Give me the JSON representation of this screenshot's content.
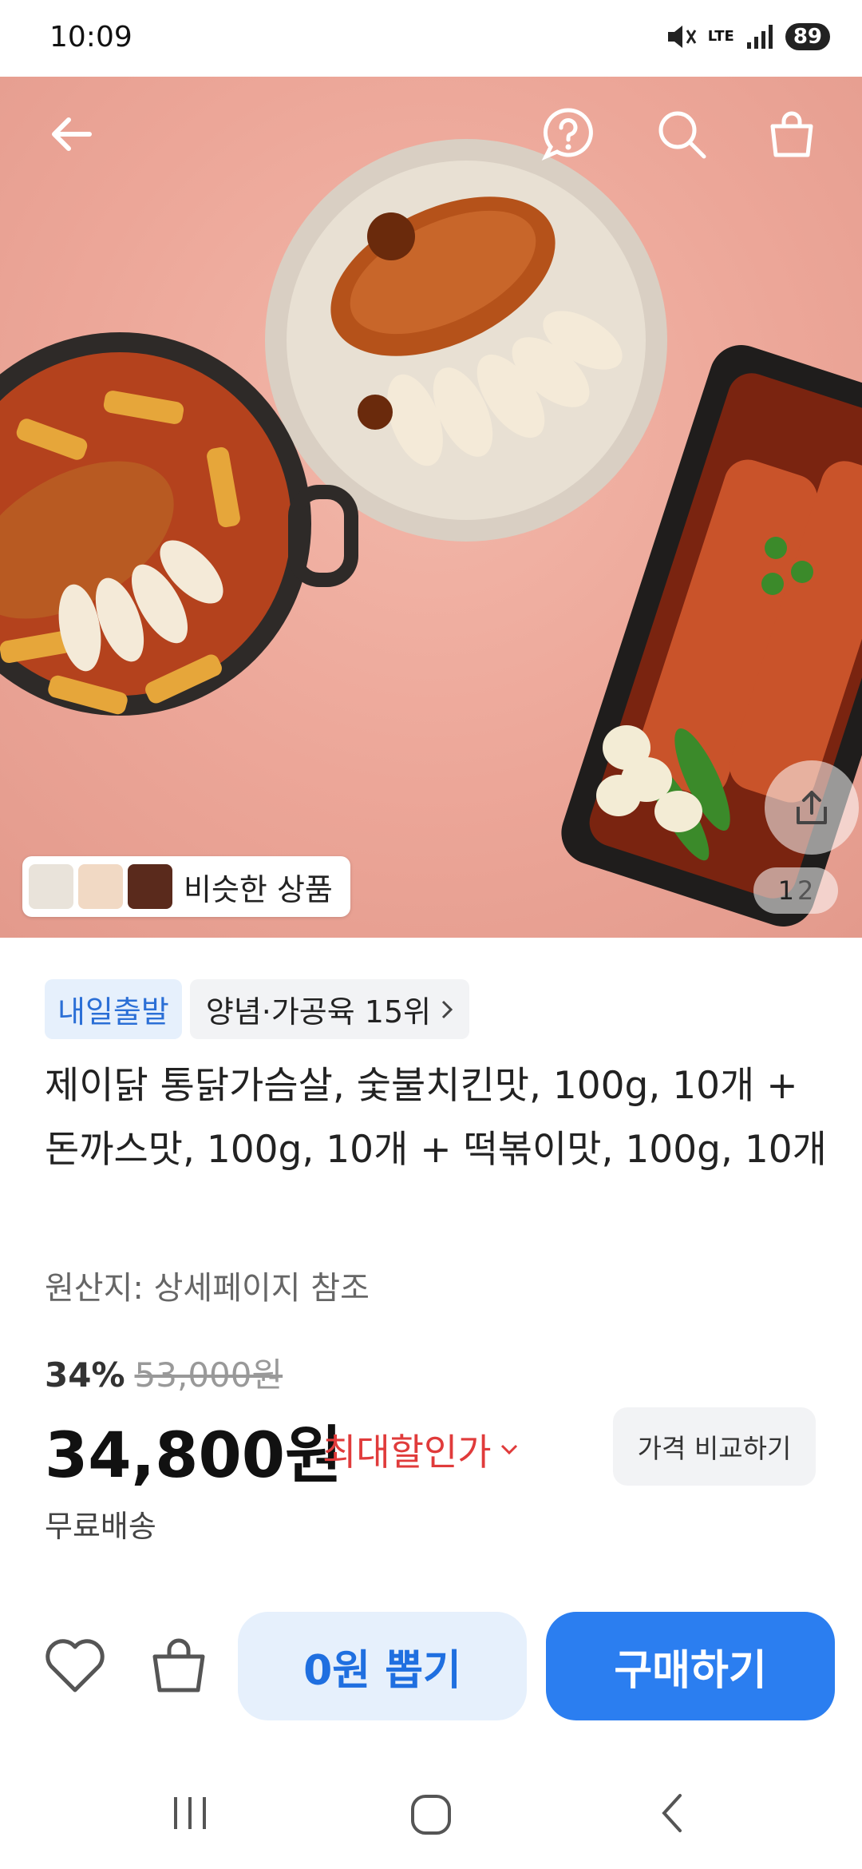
{
  "status": {
    "time": "10:09",
    "network": "LTE",
    "battery": "89"
  },
  "hero": {
    "similar_label": "비슷한 상품",
    "page_current": "1",
    "page_total": "2",
    "back_icon": "arrow-left-icon",
    "help_icon": "question-icon",
    "search_icon": "search-icon",
    "cart_icon": "shopping-bag-icon",
    "share_icon": "share-icon"
  },
  "product": {
    "badge_delivery": "내일출발",
    "badge_rank": "양념·가공육 15위",
    "title": "제이닭 통닭가슴살, 숯불치킨맛, 100g, 10개 + 돈까스맛, 100g, 10개 + 떡볶이맛, 100g, 10개",
    "origin": "원산지: 상세페이지 참조",
    "discount_pct": "34%",
    "original_price": "53,000원",
    "price": "34,800원",
    "max_discount": "최대할인가",
    "compare_label": "가격 비교하기",
    "shipping": "무료배송"
  },
  "actions": {
    "zero_draw": "0원 뽑기",
    "buy": "구매하기"
  },
  "colors": {
    "accent_blue": "#2b7ef0",
    "sale_red": "#e03b3b",
    "hero_bg": "#eca698"
  }
}
